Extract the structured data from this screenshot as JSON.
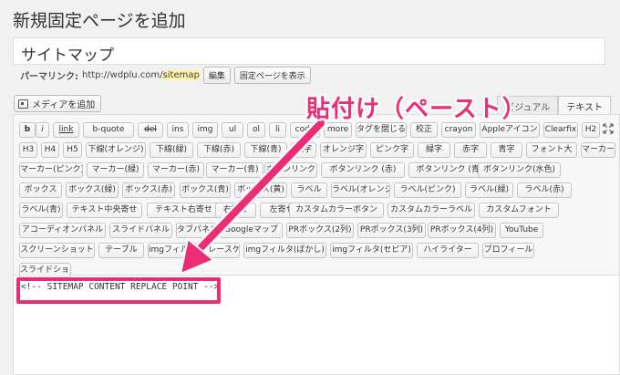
{
  "page": {
    "title": "新規固定ページを追加"
  },
  "title_input": {
    "value": "サイトマップ"
  },
  "permalink": {
    "label": "パーマリンク:",
    "url_base": "http://wdplu.com/",
    "slug": "sitemap",
    "edit_button": "編集",
    "view_button": "固定ページを表示"
  },
  "media": {
    "add_label": "メディアを追加"
  },
  "tabs": {
    "visual": "ビジュアル",
    "text": "テキスト",
    "active": "text"
  },
  "quicktags": [
    "b",
    "i",
    "link",
    "b-quote",
    "del",
    "ins",
    "img",
    "ul",
    "ol",
    "li",
    "code",
    "more",
    "タグを閉じる",
    "校正",
    "crayon",
    "Appleアイコン",
    "Clearfix",
    "H2",
    "H3",
    "H4",
    "H5",
    "下線(オレンジ)",
    "下線(緑)",
    "下線(赤)",
    "下線(青)",
    "太字",
    "オレンジ字",
    "ピンク字",
    "緑字",
    "赤字",
    "青字",
    "フォント大",
    "マーカー",
    "マーカー(ピンク)",
    "マーカー(緑)",
    "マーカー(赤)",
    "マーカー(青)",
    "ボタンリンク",
    "ボタンリンク (赤)",
    "ボタンリンク (青)",
    "ボタンリンク(水色)",
    "ボックス",
    "ボックス(緑)",
    "ボックス(赤)",
    "ボックス(青)",
    "ボックス(黄)",
    "ラベル",
    "ラベル(オレンジ)",
    "ラベル(ピンク)",
    "ラベル(緑)",
    "ラベル(赤)",
    "ラベル(青)",
    "テキスト中央寄せ",
    "テキスト右寄せ",
    "右寄せ",
    "左寄せ",
    "カスタムカラーボタン",
    "カスタムカラーラベル",
    "カスタムフォント",
    "アコーディオンパネル",
    "スライドパネル",
    "タブパネル",
    "Googleマップ",
    "PRボックス(2列)",
    "PRボックス(3列)",
    "PRボックス(4列)",
    "YouTube",
    "スクリーンショット",
    "テーブル",
    "imgフィルタ(グレースケール)",
    "imgフィルタ(ぼかし)",
    "imgフィルタ(セピア)",
    "ハイライター",
    "プロフィール",
    "スライドショー"
  ],
  "editor_content": "<!-- SITEMAP CONTENT REPLACE POINT -->",
  "annotation": {
    "text": "貼付け（ペースト）",
    "color": "#ec2d76"
  }
}
